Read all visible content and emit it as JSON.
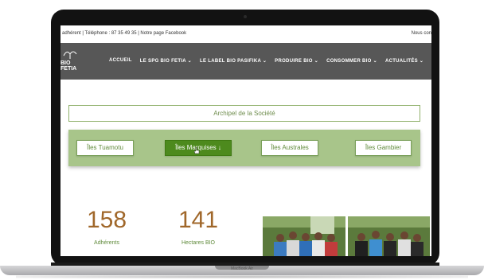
{
  "device": {
    "label": "MacBook Air"
  },
  "topbar": {
    "left_text": "adhérent | Téléphone : 87 35 49 35 | Notre page Facebook",
    "right_text": "Nous con"
  },
  "logo": {
    "text": "BIO FETIA"
  },
  "nav": {
    "items": [
      {
        "label": "ACCUEIL"
      },
      {
        "label": "LE SPG BIO FETIA ⌄"
      },
      {
        "label": "LE LABEL BIO PASIFIKA ⌄"
      },
      {
        "label": "PRODUIRE BIO ⌄"
      },
      {
        "label": "CONSOMMER BIO ⌄"
      },
      {
        "label": "ACTUALITÉS ⌄"
      }
    ]
  },
  "archipel": {
    "title": "Archipel de la Société"
  },
  "islands": {
    "buttons": [
      {
        "label": "Îles Tuamotu",
        "active": false
      },
      {
        "label": "Îles Marquises ↓",
        "active": true
      },
      {
        "label": "Îles Australes",
        "active": false
      },
      {
        "label": "Îles Gambier",
        "active": false
      }
    ]
  },
  "stats": [
    {
      "value": "158",
      "label": "Adhérents"
    },
    {
      "value": "141",
      "label": "Hectares BIO"
    }
  ],
  "colors": {
    "nav_bg": "#575757",
    "accent_green": "#4d8a1d",
    "light_green": "#a8c58a",
    "stat_orange": "#a0672a"
  }
}
